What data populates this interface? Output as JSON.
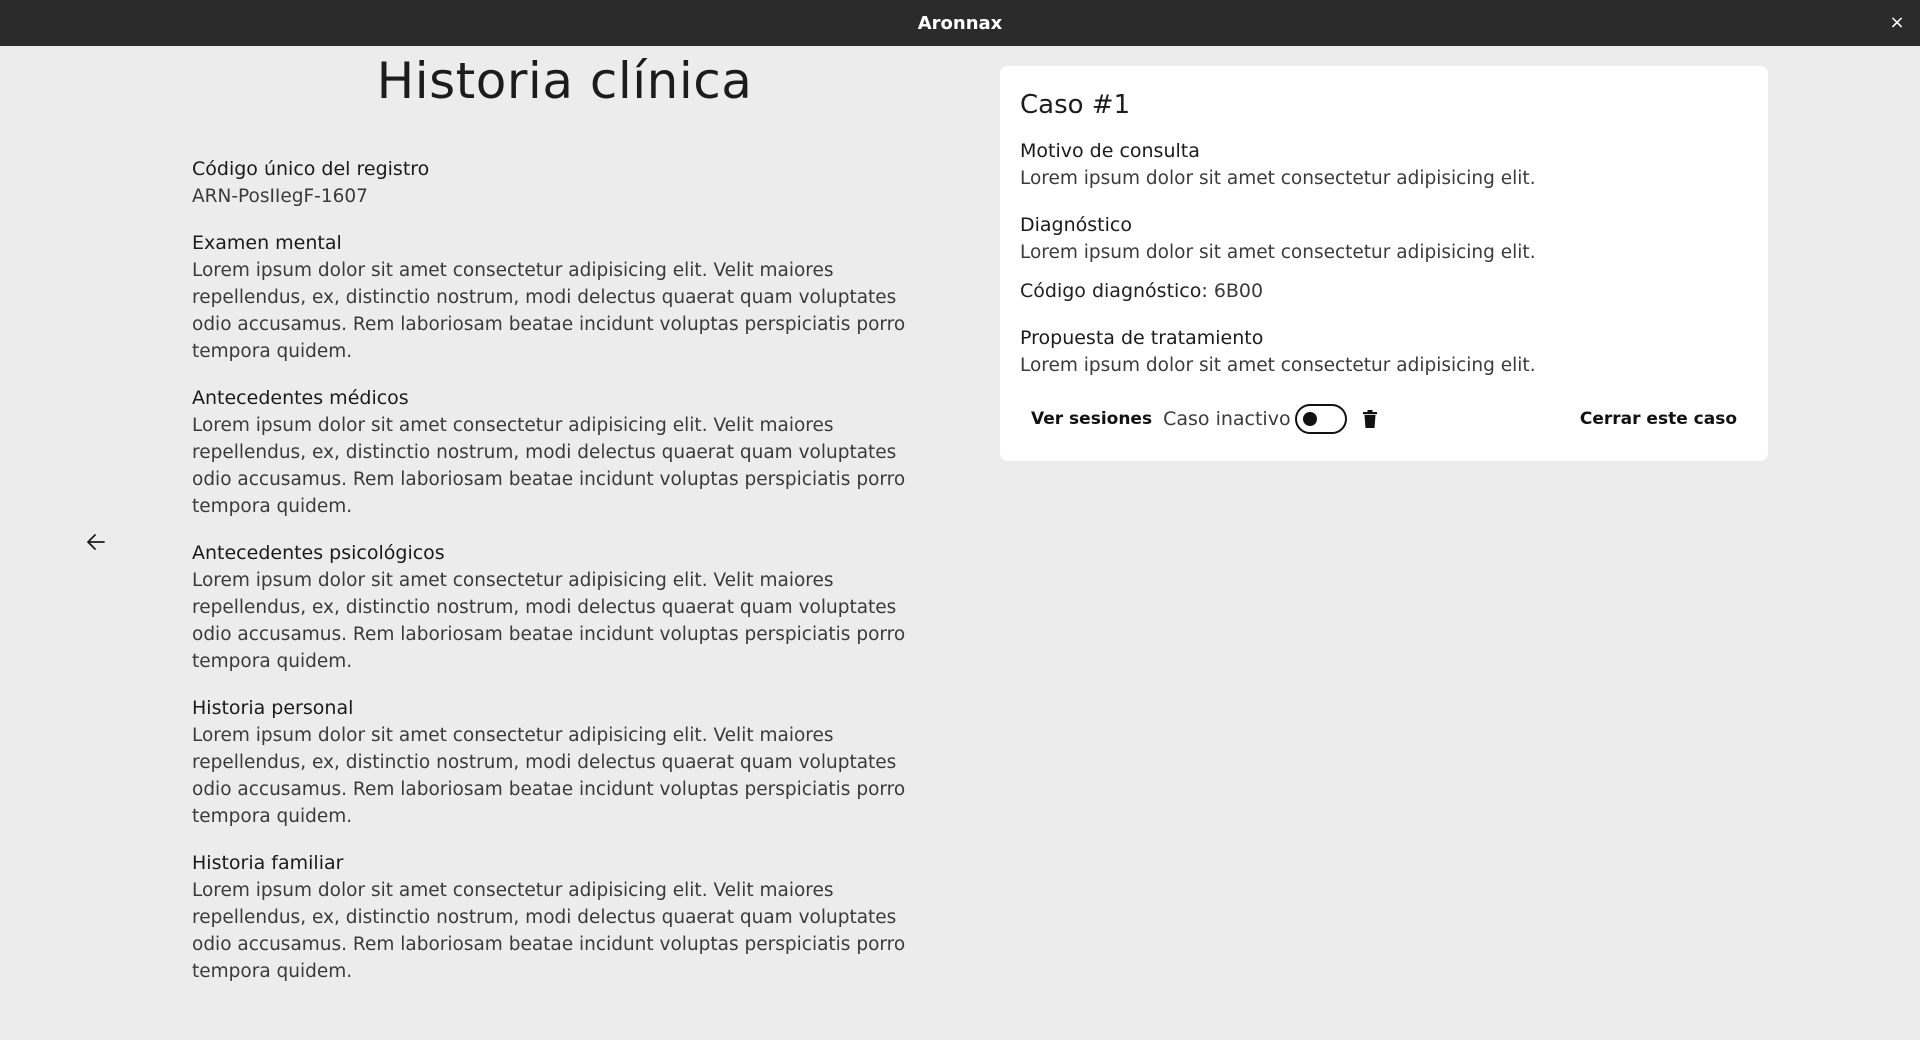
{
  "window": {
    "title": "Aronnax",
    "close_glyph": "×"
  },
  "nav": {
    "back_icon": "arrow-left-icon"
  },
  "record": {
    "page_title": "Historia clínica",
    "sections": [
      {
        "label": "Código único del registro",
        "value": "ARN-PosIIegF-1607"
      },
      {
        "label": "Examen mental",
        "value": "Lorem ipsum dolor sit amet consectetur adipisicing elit. Velit maiores repellendus, ex, distinctio nostrum, modi delectus quaerat quam voluptates odio accusamus. Rem laboriosam beatae incidunt voluptas perspiciatis porro tempora quidem."
      },
      {
        "label": "Antecedentes médicos",
        "value": "Lorem ipsum dolor sit amet consectetur adipisicing elit. Velit maiores repellendus, ex, distinctio nostrum, modi delectus quaerat quam voluptates odio accusamus. Rem laboriosam beatae incidunt voluptas perspiciatis porro tempora quidem."
      },
      {
        "label": "Antecedentes psicológicos",
        "value": "Lorem ipsum dolor sit amet consectetur adipisicing elit. Velit maiores repellendus, ex, distinctio nostrum, modi delectus quaerat quam voluptates odio accusamus. Rem laboriosam beatae incidunt voluptas perspiciatis porro tempora quidem."
      },
      {
        "label": "Historia personal",
        "value": "Lorem ipsum dolor sit amet consectetur adipisicing elit. Velit maiores repellendus, ex, distinctio nostrum, modi delectus quaerat quam voluptates odio accusamus. Rem laboriosam beatae incidunt voluptas perspiciatis porro tempora quidem."
      },
      {
        "label": "Historia familiar",
        "value": "Lorem ipsum dolor sit amet consectetur adipisicing elit. Velit maiores repellendus, ex, distinctio nostrum, modi delectus quaerat quam voluptates odio accusamus. Rem laboriosam beatae incidunt voluptas perspiciatis porro tempora quidem."
      }
    ]
  },
  "case": {
    "title": "Caso #1",
    "reason_label": "Motivo de consulta",
    "reason_value": "Lorem ipsum dolor sit amet consectetur adipisicing elit.",
    "diagnosis_label": "Diagnóstico",
    "diagnosis_value": "Lorem ipsum dolor sit amet consectetur adipisicing elit.",
    "code_label": "Código diagnóstico:",
    "code_value": "6B00",
    "treatment_label": "Propuesta de tratamiento",
    "treatment_value": "Lorem ipsum dolor sit amet consectetur adipisicing elit.",
    "sessions_button": "Ver sesiones",
    "toggle_label": "Caso inactivo",
    "toggle_on": false,
    "delete_icon": "trash-icon",
    "close_case_button": "Cerrar este caso"
  }
}
